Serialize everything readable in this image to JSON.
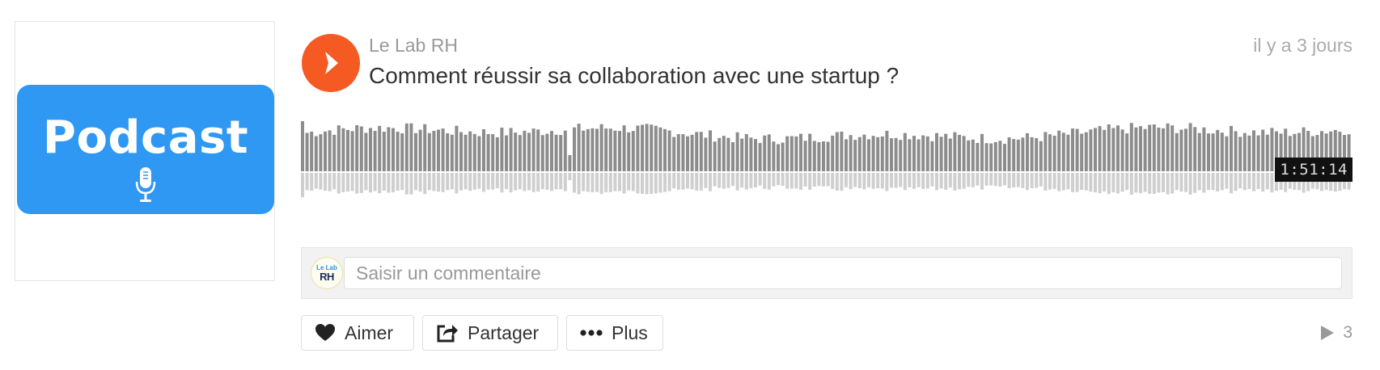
{
  "artwork": {
    "title": "Podcast",
    "background_color": "#2f98f2",
    "icon": "microphone-icon"
  },
  "track": {
    "user_name": "Le Lab RH",
    "title": "Comment réussir sa collaboration avec une startup ?",
    "posted": "il y a 3 jours",
    "duration": "1:51:14",
    "accent_color": "#f55a22"
  },
  "comment": {
    "placeholder": "Saisir un commentaire",
    "avatar_text_top": "Le Lab",
    "avatar_text_bottom": "RH"
  },
  "actions": {
    "like_label": "Aimer",
    "share_label": "Partager",
    "more_label": "Plus"
  },
  "stats": {
    "play_count": "3"
  }
}
